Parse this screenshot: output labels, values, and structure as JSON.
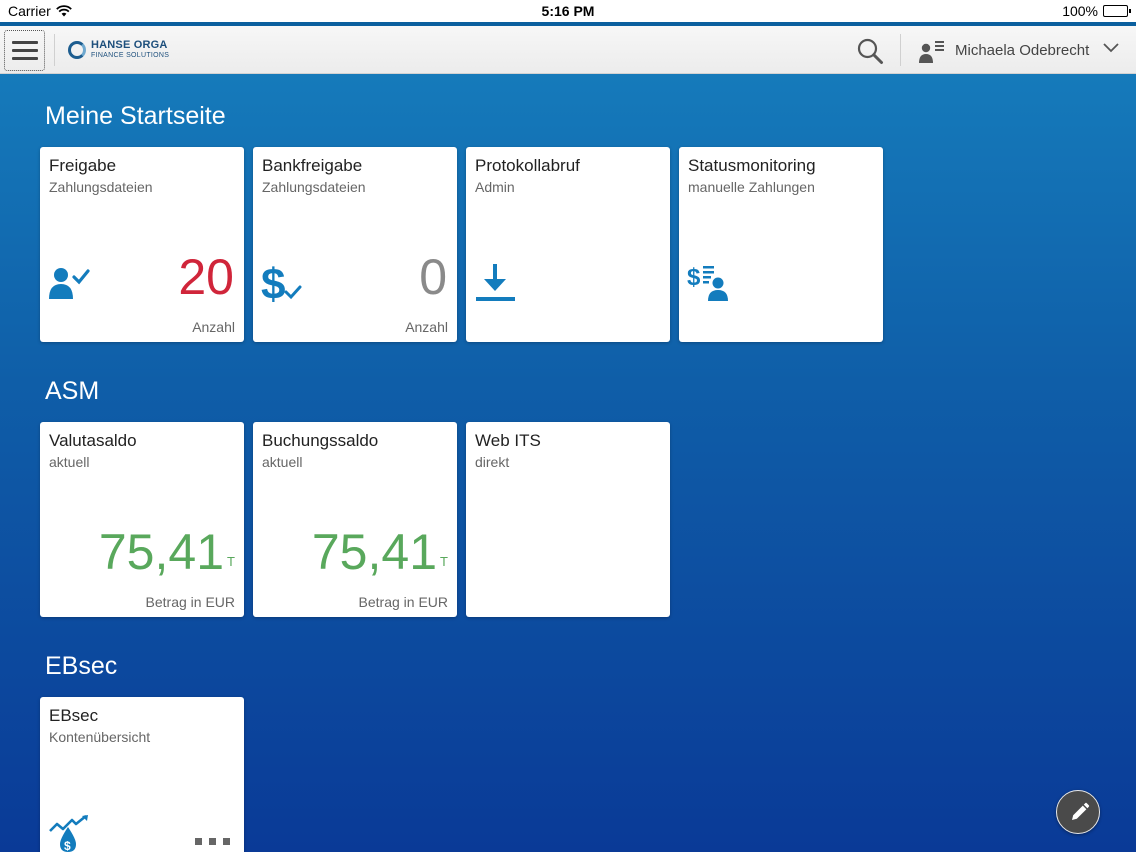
{
  "status_bar": {
    "carrier": "Carrier",
    "time": "5:16 PM",
    "battery": "100%"
  },
  "header": {
    "logo_line1": "HANSE ORGA",
    "logo_line2": "FINANCE SOLUTIONS",
    "user_name": "Michaela Odebrecht"
  },
  "groups": [
    {
      "title": "Meine Startseite",
      "tiles": [
        {
          "title": "Freigabe",
          "subtitle": "Zahlungsdateien",
          "value": "20",
          "footer": "Anzahl",
          "icon": "user-check-icon"
        },
        {
          "title": "Bankfreigabe",
          "subtitle": "Zahlungsdateien",
          "value": "0",
          "footer": "Anzahl",
          "icon": "dollar-check-icon"
        },
        {
          "title": "Protokollabruf",
          "subtitle": "Admin",
          "icon": "download-icon"
        },
        {
          "title": "Statusmonitoring",
          "subtitle": "manuelle Zahlungen",
          "icon": "payment-monitor-icon"
        }
      ]
    },
    {
      "title": "ASM",
      "tiles": [
        {
          "title": "Valutasaldo",
          "subtitle": "aktuell",
          "value": "75,41",
          "scale": "T",
          "footer": "Betrag in EUR"
        },
        {
          "title": "Buchungssaldo",
          "subtitle": "aktuell",
          "value": "75,41",
          "scale": "T",
          "footer": "Betrag in EUR"
        },
        {
          "title": "Web ITS",
          "subtitle": "direkt"
        }
      ]
    },
    {
      "title": "EBsec",
      "tiles": [
        {
          "title": "EBsec",
          "subtitle": "Kontenübersicht",
          "icon": "money-trend-icon"
        }
      ]
    }
  ],
  "colors": {
    "accent_blue": "#137cbd",
    "count_red": "#d0253a",
    "amount_green": "#59a85c"
  }
}
